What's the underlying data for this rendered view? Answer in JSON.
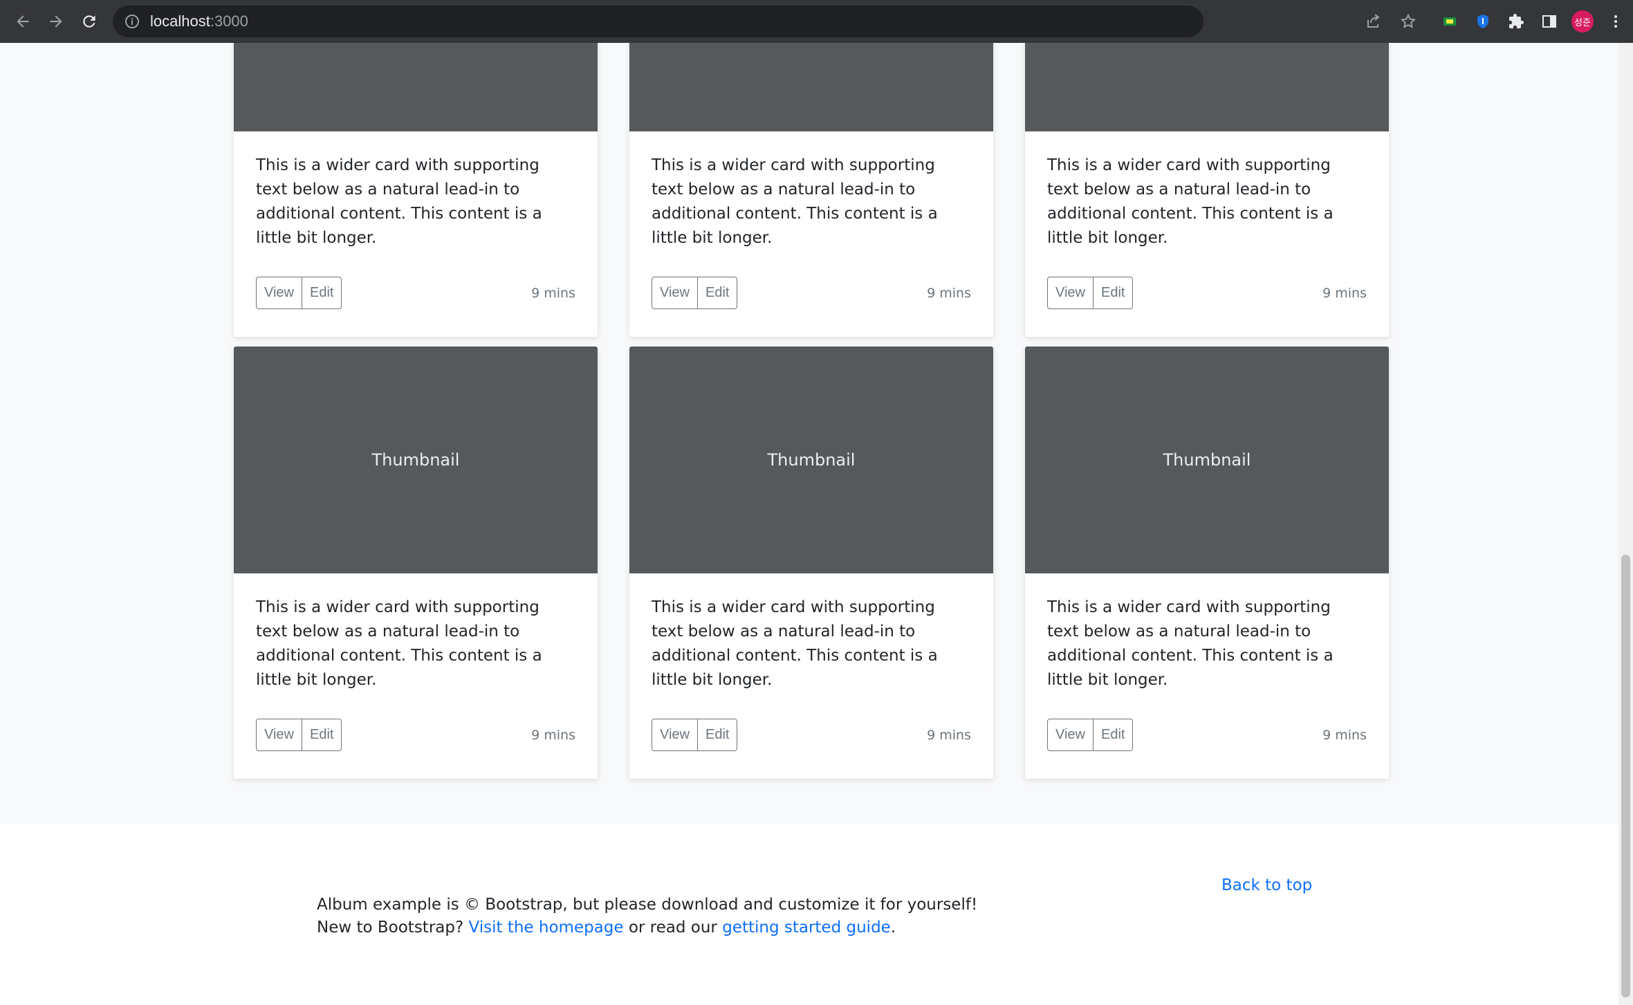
{
  "browser": {
    "url_host": "localhost",
    "url_port": ":3000",
    "profile_initials": "성준"
  },
  "cards": [
    {
      "thumbnail": "",
      "text": "This is a wider card with supporting text below as a natural lead-in to additional content. This content is a little bit longer.",
      "view_label": "View",
      "edit_label": "Edit",
      "time": "9 mins"
    },
    {
      "thumbnail": "",
      "text": "This is a wider card with supporting text below as a natural lead-in to additional content. This content is a little bit longer.",
      "view_label": "View",
      "edit_label": "Edit",
      "time": "9 mins"
    },
    {
      "thumbnail": "",
      "text": "This is a wider card with supporting text below as a natural lead-in to additional content. This content is a little bit longer.",
      "view_label": "View",
      "edit_label": "Edit",
      "time": "9 mins"
    },
    {
      "thumbnail": "Thumbnail",
      "text": "This is a wider card with supporting text below as a natural lead-in to additional content. This content is a little bit longer.",
      "view_label": "View",
      "edit_label": "Edit",
      "time": "9 mins"
    },
    {
      "thumbnail": "Thumbnail",
      "text": "This is a wider card with supporting text below as a natural lead-in to additional content. This content is a little bit longer.",
      "view_label": "View",
      "edit_label": "Edit",
      "time": "9 mins"
    },
    {
      "thumbnail": "Thumbnail",
      "text": "This is a wider card with supporting text below as a natural lead-in to additional content. This content is a little bit longer.",
      "view_label": "View",
      "edit_label": "Edit",
      "time": "9 mins"
    }
  ],
  "footer": {
    "back_to_top": "Back to top",
    "line1": "Album example is © Bootstrap, but please download and customize it for yourself!",
    "line2_prefix": "New to Bootstrap? ",
    "homepage_link": "Visit the homepage",
    "line2_mid": " or read our ",
    "guide_link": "getting started guide",
    "line2_suffix": "."
  }
}
